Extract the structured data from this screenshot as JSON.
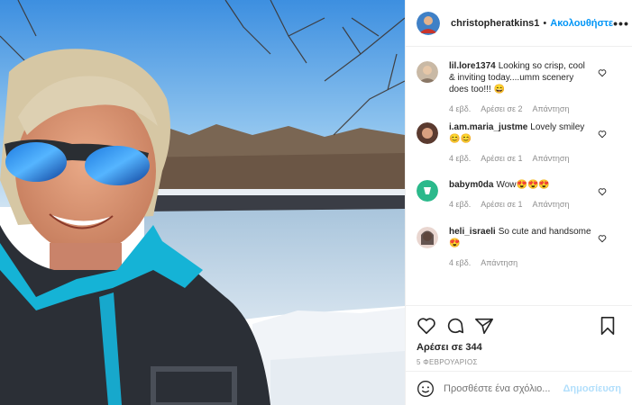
{
  "post": {
    "username": "christopheratkins1",
    "separator": "•",
    "follow_label": "Ακολουθήστε",
    "more_label": "•••",
    "image_alt": "Selfie by a frozen river on a sunny winter day"
  },
  "comments": [
    {
      "user": "lil.lore1374",
      "text": "Looking so crisp, cool & inviting today....umm scenery does too!!! 😄",
      "time": "4 εβδ.",
      "likes": "Αρέσει σε 2",
      "reply": "Απάντηση"
    },
    {
      "user": "i.am.maria_justme",
      "text": "Lovely smiley 😊😊",
      "time": "4 εβδ.",
      "likes": "Αρέσει σε 1",
      "reply": "Απάντηση"
    },
    {
      "user": "babym0da",
      "text": "Wow😍😍😍",
      "time": "4 εβδ.",
      "likes": "Αρέσει σε 1",
      "reply": "Απάντηση"
    },
    {
      "user": "heli_israeli",
      "text": "So cute and handsome 😍",
      "time": "4 εβδ.",
      "likes": "",
      "reply": "Απάντηση"
    }
  ],
  "actions": {
    "likes_text": "Αρέσει σε 344",
    "date_text": "5 ΦΕΒΡΟΥΑΡΙΟΣ"
  },
  "add_comment": {
    "placeholder": "Προσθέστε ένα σχόλιο...",
    "post_label": "Δημοσίευση"
  },
  "colors": {
    "accent": "#0095f6",
    "post_disabled": "#b2dffc",
    "meta": "#8e8e8e"
  }
}
